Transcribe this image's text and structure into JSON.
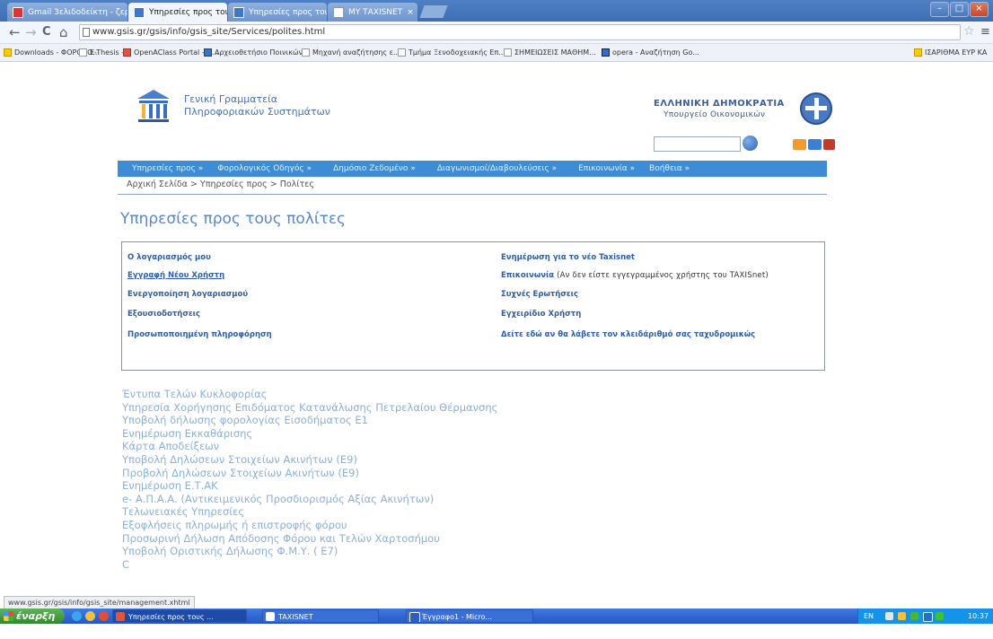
{
  "browser": {
    "tabs": [
      {
        "label": "Gmail 3ελιδοδείκτη - ζεράσο...",
        "active": false
      },
      {
        "label": "Υπηρεσίες προς τους πολίτες",
        "active": true
      },
      {
        "label": "Υπηρεσίες προς τους πολίτες",
        "active": false
      },
      {
        "label": "ΜΥ ΤΑΧΙSΝΕΤ",
        "active": false
      }
    ],
    "close_glyph": "×",
    "window_controls": {
      "minimize": "–",
      "maximize": "□",
      "close": "×"
    },
    "url": "www.gsis.gr/gsis/info/gsis_site/Services/polites.html",
    "nav": {
      "back": "←",
      "forward": "→",
      "reload": "C",
      "home": "⌂"
    },
    "star_glyph": "☆",
    "menu_glyph": "≡",
    "bookmarks": [
      "Downloads - ΦΟΡΟΛΟ...",
      "E-Thesis -",
      "OpenAClass Portal - C...",
      "Αρχειοθετήσιο Ποινικών...",
      "Μηχανή αναζήτησης ε...",
      "Τμήμα Ξενοδοχειακής Επ...",
      "ΣΗΜΕΙΩΣΕΙΣ ΜΑΘΗΜ...",
      "opera - Αναζήτηση Go...",
      "ΙΣΑΡΙΘΜΑ ΕΥΡ ΚΑ"
    ]
  },
  "site": {
    "brand_line1": "Γενική Γραμματεία",
    "brand_line2": "Πληροφοριακών Συστημάτων",
    "gov_line1": "ΕΛΛΗΝΙΚΗ ΔΗΜΟΚΡΑΤΙΑ",
    "gov_line2": "Υπουργείο Οικονομικών",
    "menu": [
      "Υπηρεσίες προς »",
      "Φορολογικός Οδηγός »",
      "Δημόσιο Ζεδομένο »",
      "Διαγωνισμοί/Διαβουλεύσεις »",
      "Επικοινωνία »",
      "Βοήθεια »"
    ],
    "breadcrumb": "Αρχική Σελίδα > Υπηρεσίες προς > Πολίτες",
    "page_title": "Υπηρεσίες προς τους πολίτες",
    "links_left": [
      "Ο λογαριασμός μου",
      "Εγγραφή Νέου Χρήστη",
      "Ενεργοποίηση λογαριασμού",
      "Εξουσιοδοτήσεις",
      "Προσωποποιημένη πληροφόρηση"
    ],
    "links_right": [
      "Ενημέρωση για το νέο Taxisnet",
      "Επικοινωνία",
      "Συχνές Ερωτήσεις",
      "Εγχειρίδιο Χρήστη",
      "Δείτε εδώ αν θα λάβετε τον κλειδάριθμό σας ταχυδρομικώς"
    ],
    "contact_note": "(Αν δεν είστε εγγεγραμμένος χρήστης του TAXISnet)",
    "services": [
      "Έντυπα Τελών Κυκλοφορίας",
      "Υπηρεσία Χορήγησης Επιδόματος Κατανάλωσης Πετρελαίου Θέρμανσης",
      "Υποβολή δήλωσης φορολογίας Εισοδήματος Ε1",
      "Ενημέρωση Εκκαθάρισης",
      "Κάρτα Αποδείξεων",
      "Υποβολή Δηλώσεων Στοιχείων Ακινήτων (Ε9)",
      "Προβολή Δηλώσεων Στοιχείων Ακινήτων (Ε9)",
      "Ενημέρωση Ε.Τ.ΑΚ",
      "e- Α.Π.Α.Α. (Αντικειμενικός Προσδιορισμός Αξίας Ακινήτων)",
      "Τελωνειακές Υπηρεσίες",
      "Εξοφλήσεις πληρωμής ή επιστροφής φόρου",
      "Προσωρινή Δήλωση Απόδοσης Φόρου και Τελών Χαρτοσήμου",
      "Υποβολή Οριστικής Δήλωσης Φ.Μ.Υ. ( Ε7)",
      "C"
    ]
  },
  "status_url": "www.gsis.gr/gsis/info/gsis_site/management.xhtml",
  "taskbar": {
    "start_label": "έναρξη",
    "tasks": [
      {
        "label": "Υπηρεσίες προς τους ...",
        "active": true
      },
      {
        "label": "TAXISNET",
        "active": false
      },
      {
        "label": "Έγγραφο1 - Micro...",
        "active": false
      }
    ],
    "lang": "EN",
    "clock": "10:37 μμ"
  },
  "colors": {
    "nav_blue": "#3e8cd3",
    "link_blue": "#2e5ea8",
    "service_link": "#8bb0d8",
    "title_blue": "#5b88c3",
    "start_green": "#3d9b37",
    "taskbar_blue": "#2456c7"
  }
}
